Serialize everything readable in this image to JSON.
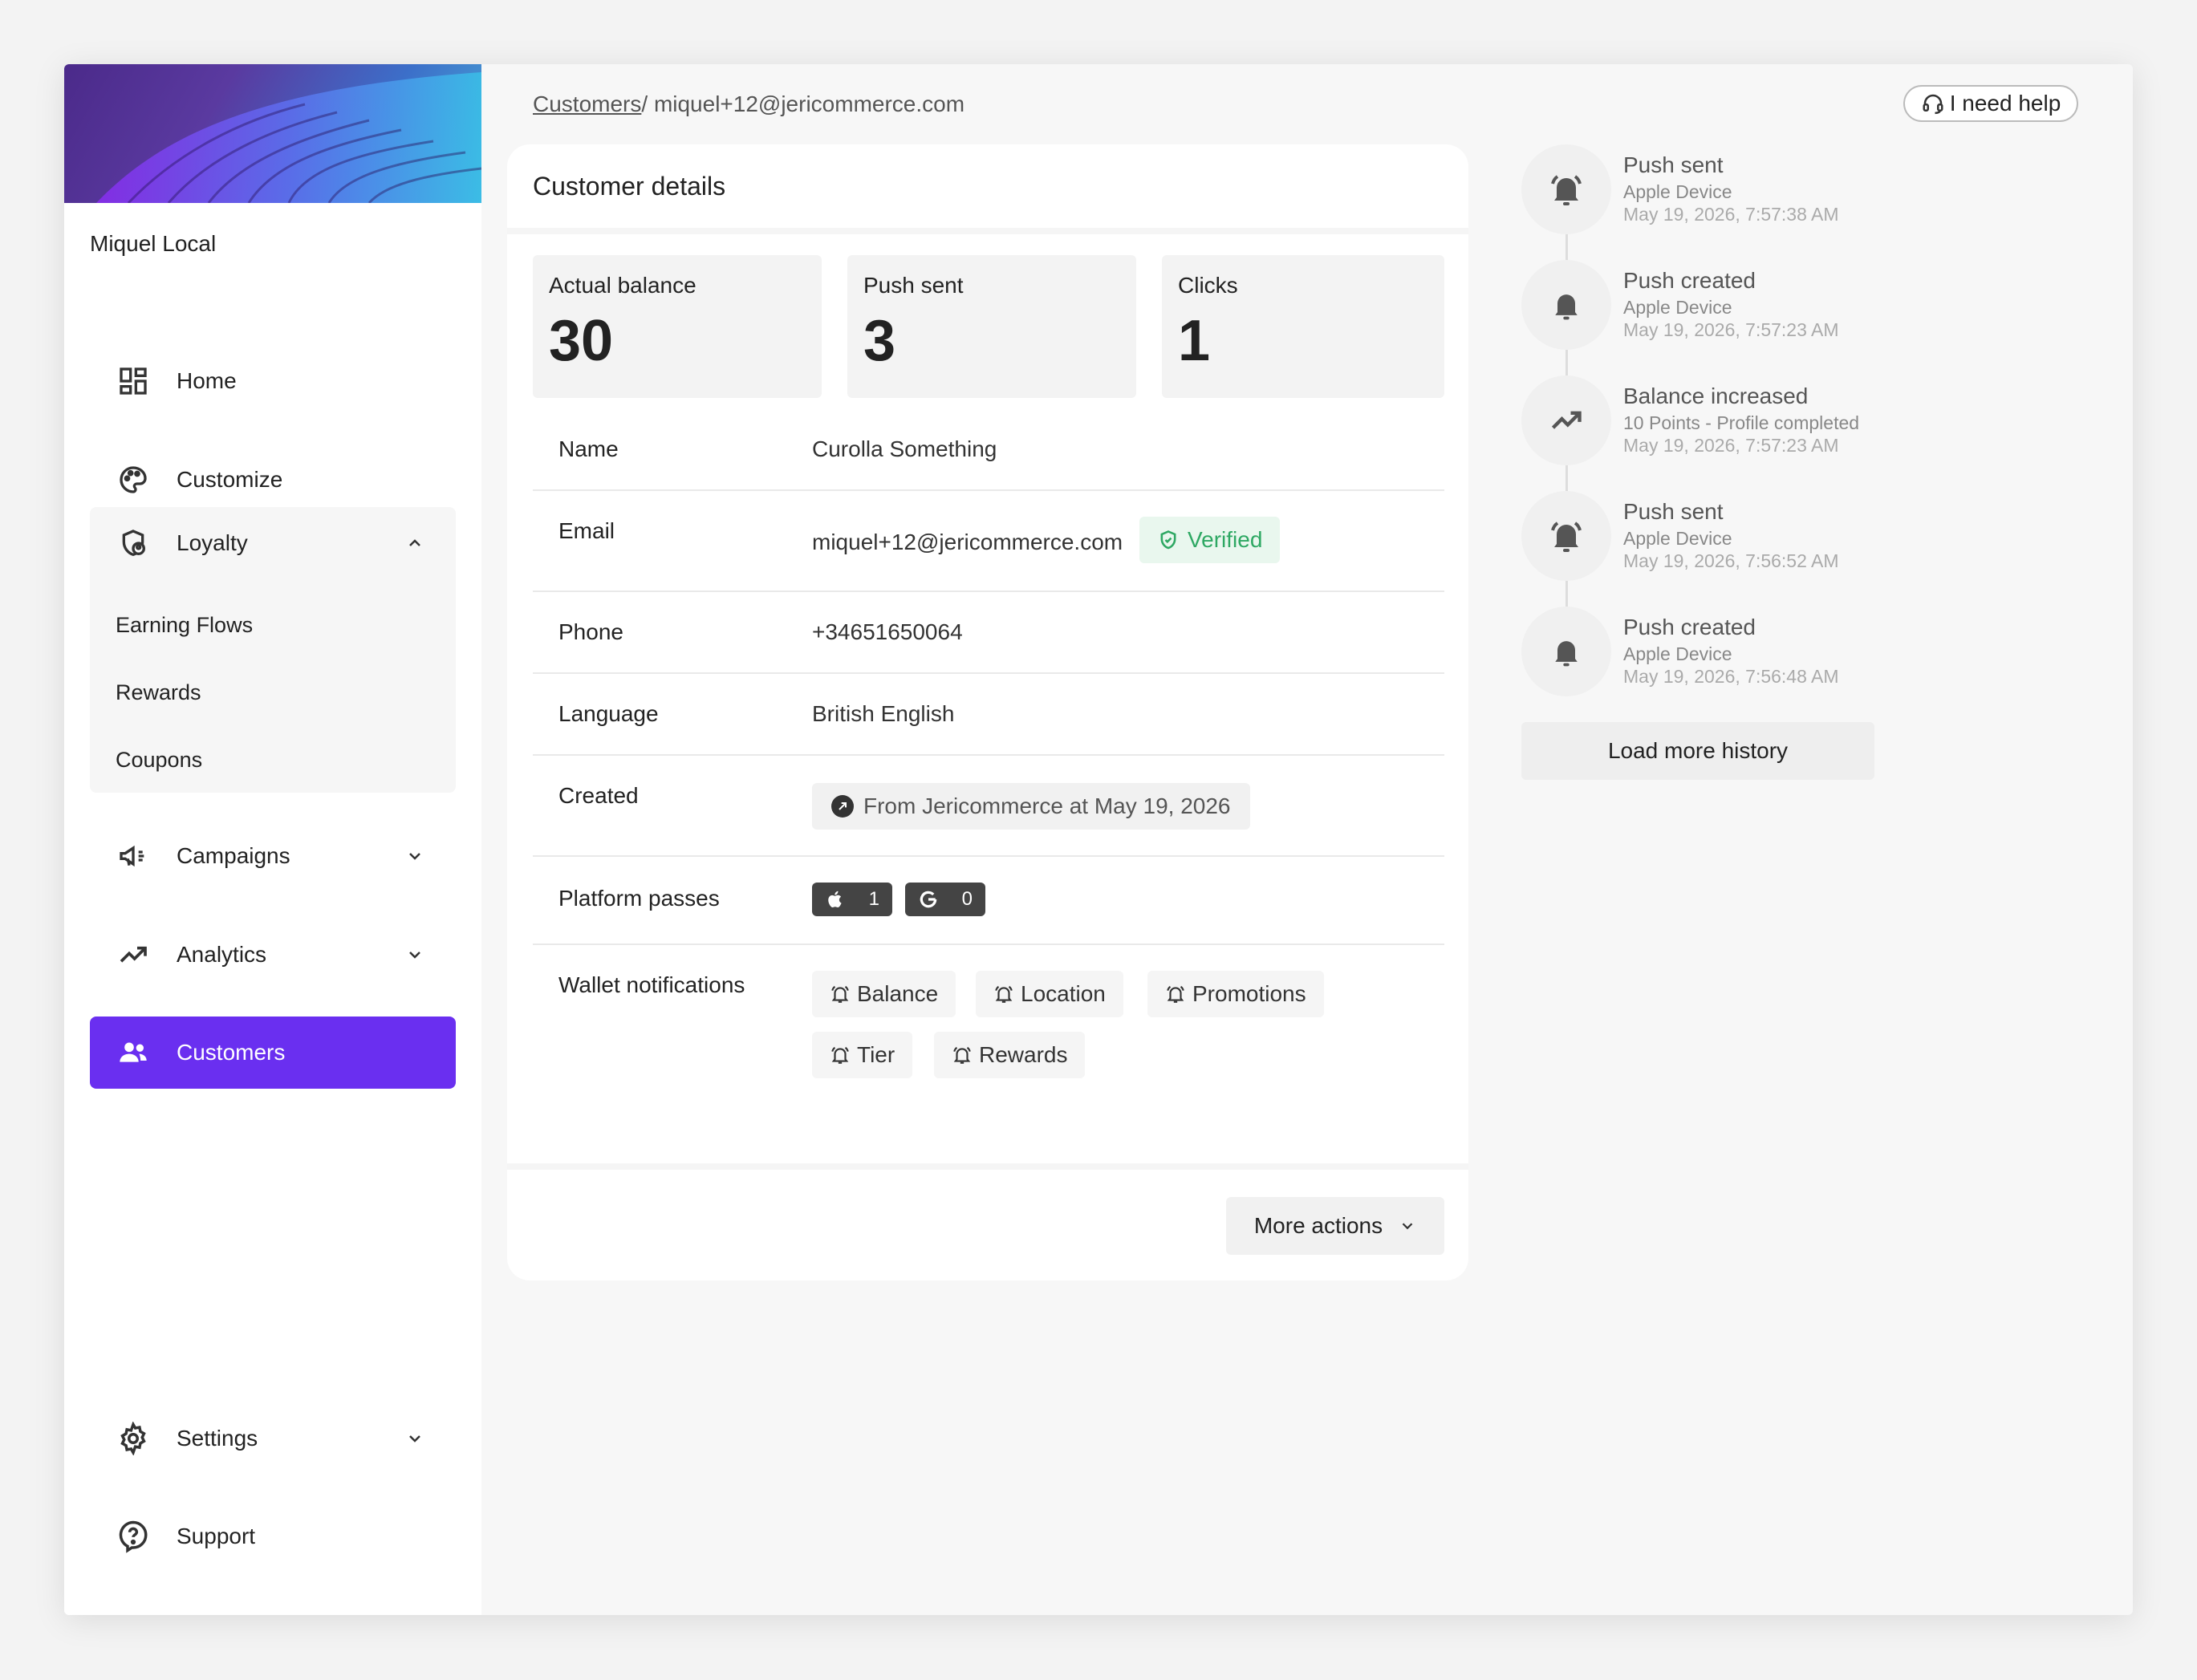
{
  "sidebar": {
    "org_name": "Miquel Local",
    "items": {
      "home": "Home",
      "customize": "Customize",
      "loyalty": "Loyalty",
      "campaigns": "Campaigns",
      "analytics": "Analytics",
      "customers": "Customers",
      "settings": "Settings",
      "support": "Support"
    },
    "loyalty_sub": [
      "Earning Flows",
      "Rewards",
      "Coupons"
    ],
    "accent_color": "#6a2ff0"
  },
  "breadcrumb": {
    "parent": "Customers",
    "separator": "/",
    "current": "miquel+12@jericommerce.com"
  },
  "help_button": "I need help",
  "customer_card": {
    "title": "Customer details",
    "stats": [
      {
        "label": "Actual balance",
        "value": "30"
      },
      {
        "label": "Push sent",
        "value": "3"
      },
      {
        "label": "Clicks",
        "value": "1"
      }
    ],
    "fields": {
      "name_label": "Name",
      "name_value": "Curolla Something",
      "email_label": "Email",
      "email_value": "miquel+12@jericommerce.com",
      "email_status": "Verified",
      "phone_label": "Phone",
      "phone_value": "+34651650064",
      "language_label": "Language",
      "language_value": "British English",
      "created_label": "Created",
      "created_value": "From Jericommerce at May 19, 2026",
      "passes_label": "Platform passes",
      "apple_count": "1",
      "google_count": "0",
      "wallet_label": "Wallet notifications",
      "wallet_notifications": [
        "Balance",
        "Location",
        "Promotions",
        "Tier",
        "Rewards"
      ]
    },
    "more_actions": "More actions"
  },
  "history": {
    "events": [
      {
        "title": "Push sent",
        "subtitle": "Apple Device",
        "time": "May 19, 2026, 7:57:38 AM",
        "icon": "bell-ring-icon"
      },
      {
        "title": "Push created",
        "subtitle": "Apple Device",
        "time": "May 19, 2026, 7:57:23 AM",
        "icon": "bell-icon"
      },
      {
        "title": "Balance increased",
        "subtitle": "10 Points - Profile completed",
        "time": "May 19, 2026, 7:57:23 AM",
        "icon": "trending-up-icon"
      },
      {
        "title": "Push sent",
        "subtitle": "Apple Device",
        "time": "May 19, 2026, 7:56:52 AM",
        "icon": "bell-ring-icon"
      },
      {
        "title": "Push created",
        "subtitle": "Apple Device",
        "time": "May 19, 2026, 7:56:48 AM",
        "icon": "bell-icon"
      }
    ],
    "load_more": "Load more history"
  }
}
